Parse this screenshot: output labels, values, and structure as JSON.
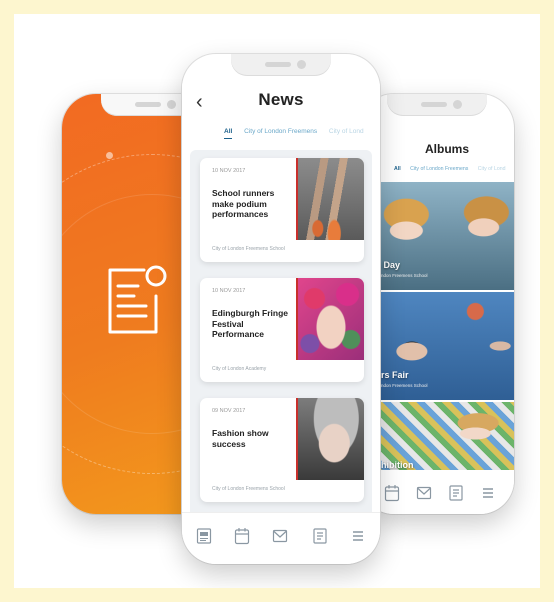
{
  "colors": {
    "page_border": "#fdf6cf",
    "splash_orange": "#f26a22",
    "tab_active": "#1a5f8a",
    "tab_inactive": "#6ba8c9",
    "card_accent": "#c9302c"
  },
  "splash": {
    "icon": "document-notification-icon"
  },
  "news_screen": {
    "back_icon": "‹",
    "title": "News",
    "tabs": [
      {
        "label": "All"
      },
      {
        "label": "City of London Freemens"
      },
      {
        "label": "City of Lond"
      }
    ],
    "cards": [
      {
        "date": "10 NOV 2017",
        "headline": "School runners make podium performances",
        "school": "City of London Freemens School"
      },
      {
        "date": "10 NOV 2017",
        "headline": "Edingburgh Fringe Festival Performance",
        "school": "City of London Academy"
      },
      {
        "date": "09 NOV 2017",
        "headline": "Fashion show success",
        "school": "City of London Freemens School"
      }
    ],
    "tabbar_icons": [
      "news-icon",
      "calendar-icon",
      "mail-icon",
      "document-icon",
      "menu-icon"
    ]
  },
  "albums_screen": {
    "title": "Albums",
    "tabs": [
      {
        "label": "All"
      },
      {
        "label": "City of London Freemens"
      },
      {
        "label": "City of Lond"
      }
    ],
    "albums": [
      {
        "label": "s Day",
        "sub": "London Freemens School"
      },
      {
        "label": "ers Fair",
        "sub": "London Freemens School"
      },
      {
        "label": "xhibition",
        "sub": ""
      }
    ],
    "tabbar_icons": [
      "calendar-icon",
      "mail-icon",
      "document-icon",
      "menu-icon"
    ]
  }
}
